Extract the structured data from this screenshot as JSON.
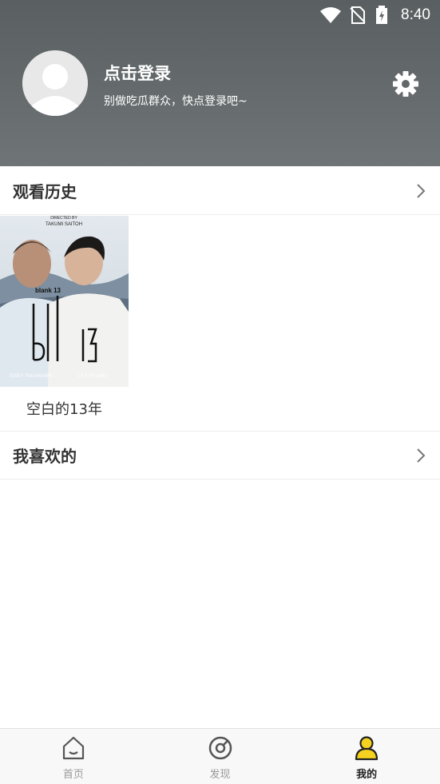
{
  "status_bar": {
    "time": "8:40"
  },
  "profile": {
    "login_title": "点击登录",
    "login_subtitle": "别做吃瓜群众，快点登录吧~"
  },
  "history": {
    "title": "观看历史",
    "items": [
      {
        "title": "空白的13年",
        "poster_texts": {
          "top_credit": "DIRECTED BY",
          "director": "TAKUMI SAITOH",
          "main_title": "blank 13",
          "left_cast": "ISSEY TAKAHASHI",
          "right_cast": "LILY FRANKY"
        }
      }
    ]
  },
  "favorites": {
    "title": "我喜欢的"
  },
  "tabbar": {
    "tabs": [
      {
        "label": "首页",
        "icon": "home-icon",
        "active": false
      },
      {
        "label": "发现",
        "icon": "discover-icon",
        "active": false
      },
      {
        "label": "我的",
        "icon": "profile-icon",
        "active": true
      }
    ]
  },
  "colors": {
    "accent": "#f5d21f",
    "header_bg": "#60666a",
    "inactive": "#9a9a9a"
  }
}
